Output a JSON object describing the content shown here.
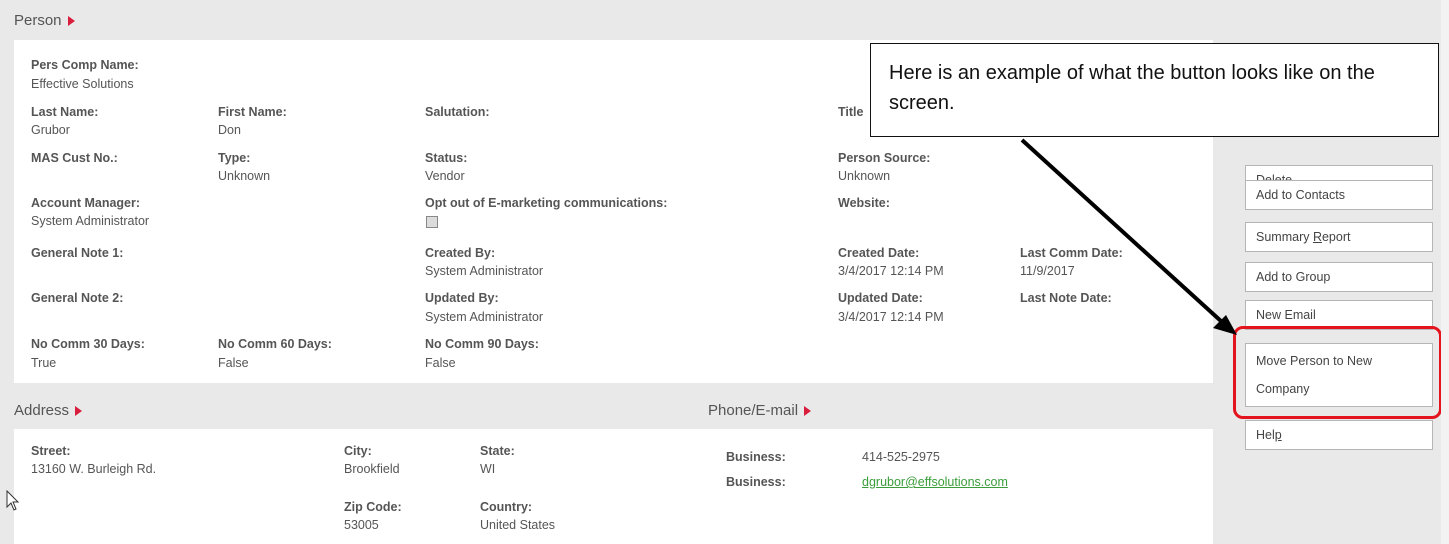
{
  "person_section": {
    "title": "Person",
    "pers_comp_name": {
      "label": "Pers Comp Name:",
      "value": "Effective Solutions"
    },
    "last_name": {
      "label": "Last Name:",
      "value": "Grubor"
    },
    "first_name": {
      "label": "First Name:",
      "value": "Don"
    },
    "salutation": {
      "label": "Salutation:",
      "value": ""
    },
    "title_field": {
      "label": "Title",
      "value": ""
    },
    "mas_cust_no": {
      "label": "MAS Cust No.:",
      "value": ""
    },
    "type": {
      "label": "Type:",
      "value": "Unknown"
    },
    "status": {
      "label": "Status:",
      "value": "Vendor"
    },
    "person_source": {
      "label": "Person Source:",
      "value": "Unknown"
    },
    "account_manager": {
      "label": "Account Manager:",
      "value": "System Administrator"
    },
    "opt_out": {
      "label": "Opt out of E-marketing communications:"
    },
    "website": {
      "label": "Website:",
      "value": ""
    },
    "general_note_1": {
      "label": "General Note 1:",
      "value": ""
    },
    "created_by": {
      "label": "Created By:",
      "value": "System Administrator"
    },
    "created_date": {
      "label": "Created Date:",
      "value": "3/4/2017 12:14 PM"
    },
    "last_comm_date": {
      "label": "Last Comm Date:",
      "value": "11/9/2017"
    },
    "general_note_2": {
      "label": "General Note 2:",
      "value": ""
    },
    "updated_by": {
      "label": "Updated By:",
      "value": "System Administrator"
    },
    "updated_date": {
      "label": "Updated Date:",
      "value": "3/4/2017 12:14 PM"
    },
    "last_note_date": {
      "label": "Last Note Date:",
      "value": ""
    },
    "no_comm_30": {
      "label": "No Comm 30 Days:",
      "value": "True"
    },
    "no_comm_60": {
      "label": "No Comm 60 Days:",
      "value": "False"
    },
    "no_comm_90": {
      "label": "No Comm 90 Days:",
      "value": "False"
    }
  },
  "address_section": {
    "title": "Address",
    "street": {
      "label": "Street:",
      "value": "13160 W. Burleigh Rd."
    },
    "city": {
      "label": "City:",
      "value": "Brookfield"
    },
    "state": {
      "label": "State:",
      "value": "WI"
    },
    "zip": {
      "label": "Zip Code:",
      "value": "53005"
    },
    "country": {
      "label": "Country:",
      "value": "United States"
    }
  },
  "phone_section": {
    "title": "Phone/E-mail",
    "rows": [
      {
        "label": "Business:",
        "value": "414-525-2975"
      },
      {
        "label": "Business:",
        "value": "dgrubor@effsolutions.com"
      }
    ]
  },
  "actions": {
    "delete": "Delete",
    "add_to_contacts": "Add to Contacts",
    "summary_report_pre": "Summary ",
    "summary_report_u": "R",
    "summary_report_post": "eport",
    "add_to_group": "Add to Group",
    "new_email": "New Email",
    "move_line1": "Move Person to New",
    "move_line2": "Company",
    "help_pre": "Hel",
    "help_u": "p"
  },
  "callout": {
    "text": "Here is an example of what the button looks like on the screen."
  },
  "colors": {
    "highlight": "#e3141e",
    "accent_triangle": "#d81e3c",
    "link": "#3a9d3a"
  }
}
